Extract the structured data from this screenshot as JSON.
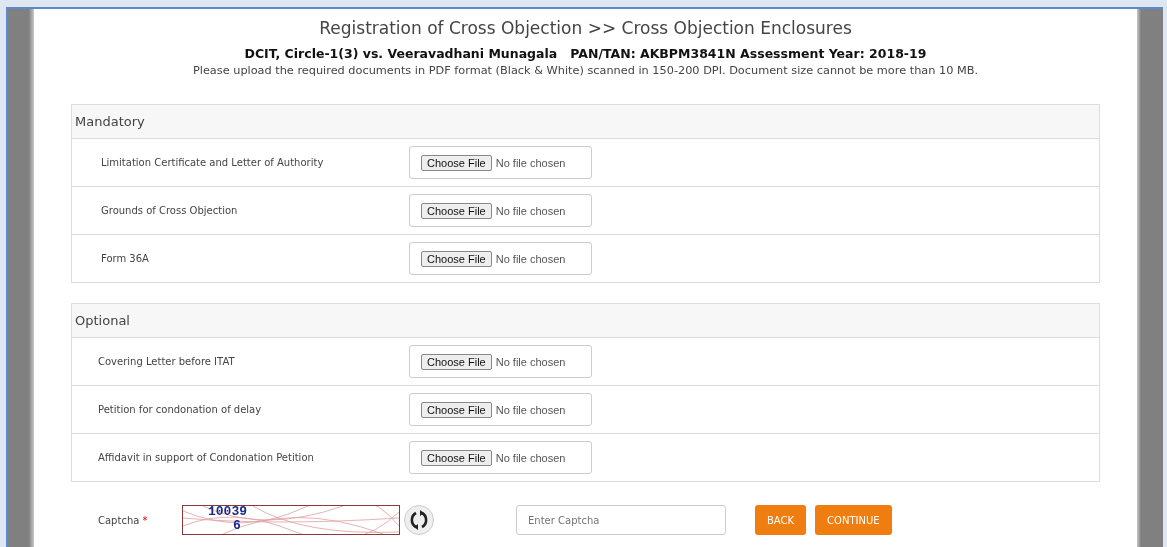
{
  "title": "Registration of Cross Objection >> Cross Objection Enclosures",
  "case_line": "DCIT, Circle-1(3) vs. Veeravadhani Munagala   PAN/TAN: AKBPM3841N Assessment Year: 2018-19",
  "instructions": "Please upload the required documents in PDF format (Black & White) scanned in 150-200 DPI. Document size cannot be more than 10 MB.",
  "sections": [
    {
      "heading": "Mandatory",
      "rows": [
        {
          "label": "Limitation Certificate and Letter of Authority",
          "button": "Choose File",
          "status": "No file chosen"
        },
        {
          "label": "Grounds of Cross Objection",
          "button": "Choose File",
          "status": "No file chosen"
        },
        {
          "label": "Form 36A",
          "button": "Choose File",
          "status": "No file chosen"
        }
      ]
    },
    {
      "heading": "Optional",
      "rows": [
        {
          "label": "Covering Letter before ITAT",
          "button": "Choose File",
          "status": "No file chosen"
        },
        {
          "label": "Petition for condonation of delay",
          "button": "Choose File",
          "status": "No file chosen"
        },
        {
          "label": "Affidavit in support of Condonation Petition",
          "button": "Choose File",
          "status": "No file chosen"
        }
      ]
    }
  ],
  "captcha": {
    "label": "Captcha",
    "required_mark": "*",
    "code": "10039",
    "code_2": "6",
    "placeholder": "Enter Captcha"
  },
  "buttons": [
    "BACK",
    "CONTINUE"
  ]
}
